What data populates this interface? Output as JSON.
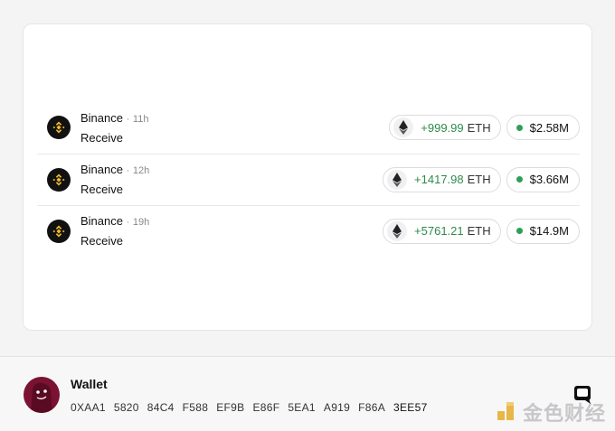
{
  "transactions": [
    {
      "source": "Binance",
      "ago": "11h",
      "type": "Receive",
      "amount": "+999.99",
      "unit": "ETH",
      "usd": "$2.58M"
    },
    {
      "source": "Binance",
      "ago": "12h",
      "type": "Receive",
      "amount": "+1417.98",
      "unit": "ETH",
      "usd": "$3.66M"
    },
    {
      "source": "Binance",
      "ago": "19h",
      "type": "Receive",
      "amount": "+5761.21",
      "unit": "ETH",
      "usd": "$14.9M"
    }
  ],
  "separator": "·",
  "wallet": {
    "title": "Wallet",
    "address_groups": [
      "0XAA1",
      "5820",
      "84C4",
      "F588",
      "EF9B",
      "E86F",
      "5EA1",
      "A919",
      "F86A",
      "3EE57"
    ]
  },
  "watermark": {
    "text": "金色财经"
  },
  "colors": {
    "positive": "#2e8b4a",
    "status_dot": "#2e9f55",
    "avatar": "#7a1232",
    "binance_yellow": "#f3ba2f"
  },
  "icons": {
    "exchange": "binance-icon",
    "asset": "ethereum-icon",
    "status": "status-dot",
    "chat": "chat-icon"
  }
}
